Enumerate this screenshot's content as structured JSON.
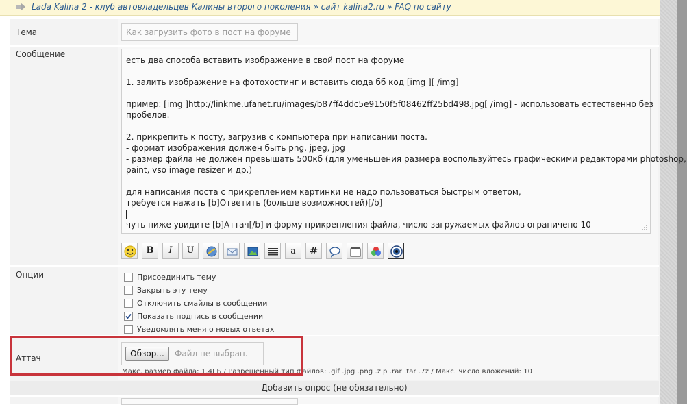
{
  "breadcrumb": {
    "items": [
      "Lada Kalina 2 - клуб автовладельцев Калины второго поколения",
      "сайт kalina2.ru",
      "FAQ по сайту"
    ],
    "separator": "»"
  },
  "form": {
    "subject_label": "Тема",
    "subject_value": "Как загрузить фото в пост на форуме",
    "message_label": "Сообщение",
    "message_lines": [
      "есть два способа вставить изображение в свой пост на форуме",
      "",
      "1. залить изображение на фотохостинг и вставить сюда бб код [img ][ /img]",
      "",
      "пример: [img ]http://linkme.ufanet.ru/images/b87ff4ddc5e9150f5f08462ff25bd498.jpg[ /img] - использовать естественно без",
      "пробелов.",
      "",
      "2. прикрепить к посту, загрузив с компьютера при написании поста.",
      "- формат изображения должен быть png, jpeg, jpg",
      "- размер файла не должен превышать 500кб (для уменьшения размера воспользуйтесь графическими редакторами photoshop,",
      "paint, vso image resizer и др.)",
      "",
      "для написания поста с прикреплением картинки не надо пользоваться быстрым ответом,",
      "требуется нажать [b]Ответить (больше возможностей)[/b]",
      "",
      "чуть ниже увидите [b]Аттач[/b] и форму прикрепления файла, число загружаемых файлов ограничено 10"
    ],
    "toolbar": [
      {
        "icon": "smiley-icon",
        "text": ""
      },
      {
        "icon": "bold-icon",
        "text": "B"
      },
      {
        "icon": "italic-icon",
        "text": "I"
      },
      {
        "icon": "underline-icon",
        "text": "U"
      },
      {
        "icon": "link-icon",
        "text": ""
      },
      {
        "icon": "email-icon",
        "text": ""
      },
      {
        "icon": "image-icon",
        "text": ""
      },
      {
        "icon": "align-icon",
        "text": ""
      },
      {
        "icon": "font-icon",
        "text": "a"
      },
      {
        "icon": "hash-icon",
        "text": "#"
      },
      {
        "icon": "quote-icon",
        "text": ""
      },
      {
        "icon": "video-icon",
        "text": ""
      },
      {
        "icon": "color-icon",
        "text": ""
      },
      {
        "icon": "eye-icon",
        "text": ""
      }
    ],
    "options_label": "Опции",
    "options": [
      {
        "label": "Присоединить тему",
        "checked": false
      },
      {
        "label": "Закрыть эту тему",
        "checked": false
      },
      {
        "label": "Отключить смайлы в сообщении",
        "checked": false
      },
      {
        "label": "Показать подпись в сообщении",
        "checked": true
      },
      {
        "label": "Уведомлять меня о новых ответах",
        "checked": false
      }
    ],
    "attach_label": "Аттач",
    "browse_label": "Обзор...",
    "file_status": "Файл не выбран.",
    "file_info": "Макс. размер файла: 1.4ГБ / Разрешенный тип файлов: .gif .jpg .png .zip .rar .tar .7z / Макс. число вложений: 10",
    "poll_label": "Добавить опрос (не обязательно)"
  },
  "colors": {
    "breadcrumb_bg": "#fdf7d6",
    "link": "#2a5a8f",
    "highlight": "#c8343b"
  }
}
